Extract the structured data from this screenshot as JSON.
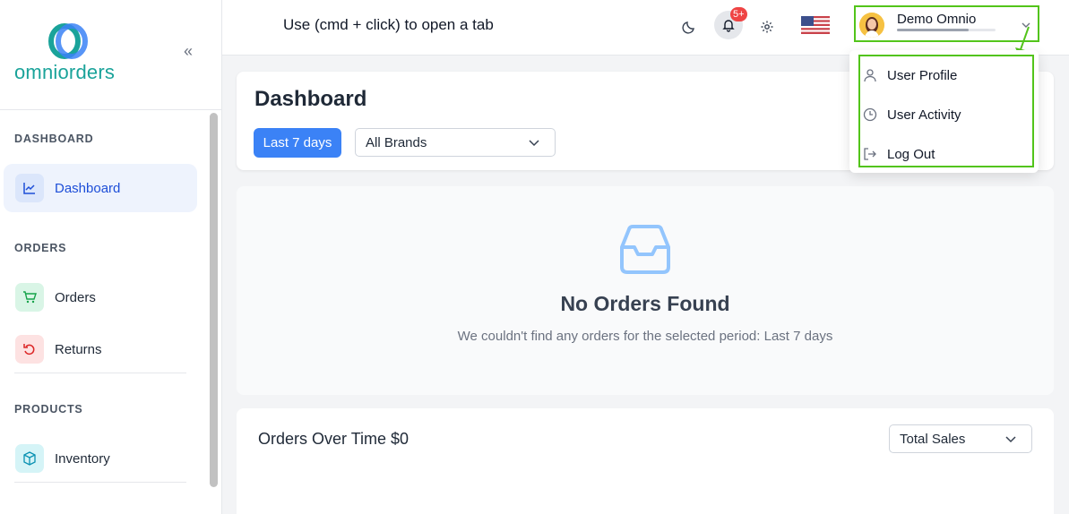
{
  "sidebar": {
    "logo_text": "omniorders",
    "collapse_glyph": "«",
    "sections": {
      "dashboard": "DASHBOARD",
      "orders": "ORDERS",
      "products": "PRODUCTS"
    },
    "items": {
      "dashboard": "Dashboard",
      "orders": "Orders",
      "returns": "Returns",
      "inventory": "Inventory"
    }
  },
  "header": {
    "hint": "Use (cmd + click) to open a tab",
    "notification_badge": "5+",
    "user_name": "Demo Omnio",
    "user_progress": 0.73
  },
  "user_menu": {
    "items": [
      "User Profile",
      "User Activity",
      "Log Out"
    ]
  },
  "dashboard": {
    "title": "Dashboard",
    "range_label": "Last 7 days",
    "brand_filter": "All Brands"
  },
  "empty_state": {
    "title": "No Orders Found",
    "message": "We couldn't find any orders for the selected period: Last 7 days"
  },
  "orders_chart": {
    "title": "Orders Over Time $0",
    "metric": "Total Sales"
  },
  "colors": {
    "accent": "#3b82f6",
    "brand_teal": "#1aa39a",
    "highlight": "#52c41a",
    "badge": "#ef4444"
  },
  "icons": [
    "logo-icon",
    "collapse-icon",
    "chart-icon",
    "cart-icon",
    "return-icon",
    "box-icon",
    "moon-icon",
    "bell-icon",
    "gear-icon",
    "us-flag-icon",
    "chevron-down-icon",
    "user-icon",
    "clock-icon",
    "logout-icon",
    "inbox-icon"
  ]
}
